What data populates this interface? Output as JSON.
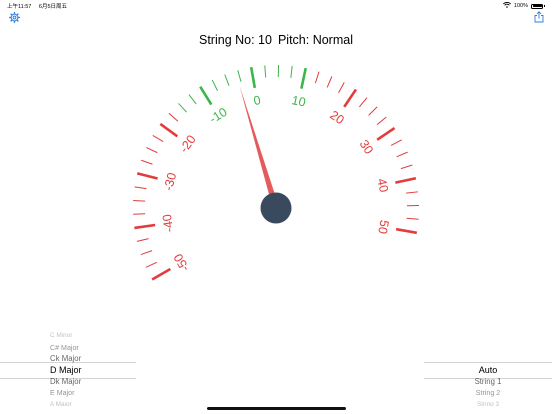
{
  "status_bar": {
    "time": "上午11:57",
    "date": "6月5日周五",
    "battery": "100%"
  },
  "toolbar": {
    "settings_icon": "gear-icon",
    "share_icon": "share-icon",
    "accent": "#2f7de1"
  },
  "header": {
    "string_label": "String No: 10",
    "pitch_label": "Pitch: Normal"
  },
  "gauge": {
    "labels": [
      "-50",
      "-40",
      "-30",
      "-20",
      "-10",
      "0",
      "10",
      "20",
      "30",
      "40",
      "50"
    ],
    "min": -50,
    "max": 50,
    "in_tune_range": [
      -15,
      10
    ],
    "reading": -3,
    "colors": {
      "red": "#e23c3c",
      "green": "#3cb54a",
      "needle": "#e45b5b",
      "hub": "#3a4a5e"
    }
  },
  "key_picker": {
    "options": [
      "C Minor",
      "C# Major",
      "C Major",
      "D Major",
      "D Major",
      "E Major",
      "A Major"
    ],
    "display": [
      "C Minor",
      "C# Major",
      "Ck Major",
      "D Major",
      "Dk Major",
      "E Major",
      "A Major"
    ],
    "selected": "D Major"
  },
  "string_picker": {
    "options": [
      "Auto",
      "String 1",
      "String 2",
      "String 3"
    ],
    "selected": "Auto"
  }
}
